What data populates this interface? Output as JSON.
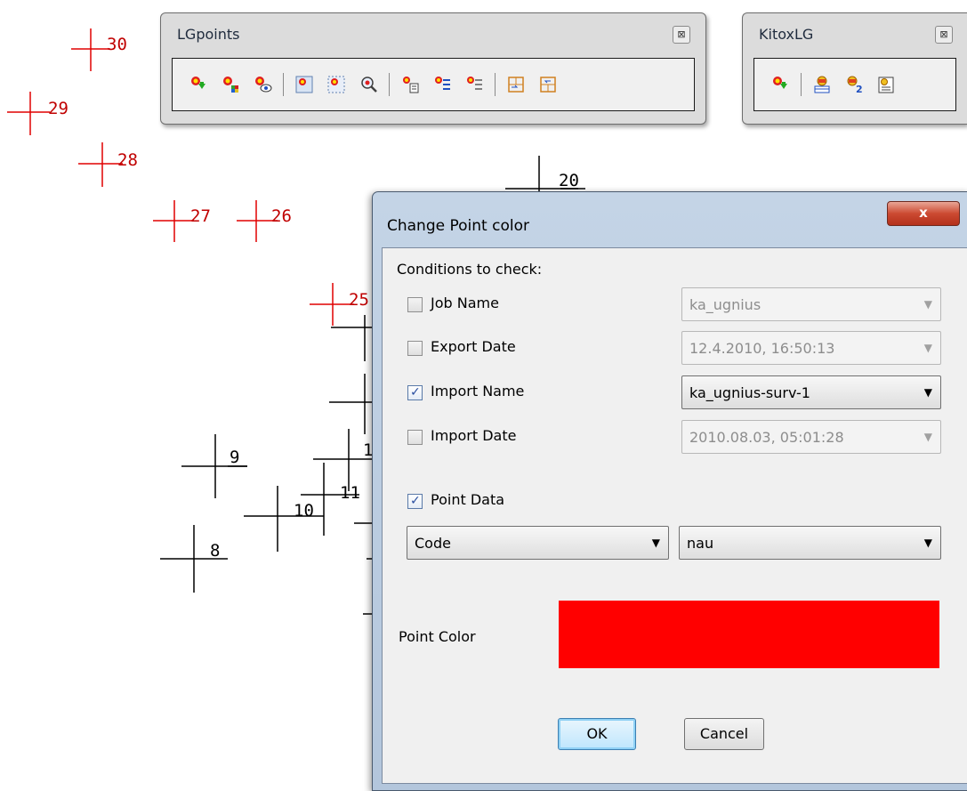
{
  "canvas": {
    "point_labels": [
      "30",
      "29",
      "28",
      "27",
      "26",
      "25",
      "20",
      "9",
      "11",
      "10",
      "8",
      "1"
    ]
  },
  "toolbars": {
    "lgpoints": {
      "title": "LGpoints",
      "close_glyph": "⊠",
      "buttons": [
        "point-download-icon",
        "point-color-icon",
        "point-view-icon",
        "point-select-icon",
        "point-area-select-icon",
        "point-zoom-icon",
        "point-list-icon",
        "point-attributes-icon",
        "point-attributes-alt-icon",
        "export-frame-icon",
        "export-frame-alt-icon"
      ]
    },
    "kitoxlg": {
      "title": "KitoxLG",
      "close_glyph": "⊠",
      "buttons": [
        "kitox-download-icon",
        "kitox-table-icon",
        "kitox-convert-icon",
        "kitox-report-icon"
      ]
    }
  },
  "dialog": {
    "title": "Change Point color",
    "close_label": "x",
    "conditions_label": "Conditions to check:",
    "conditions": [
      {
        "label": "Job Name",
        "checked": false,
        "value": "ka_ugnius"
      },
      {
        "label": "Export Date",
        "checked": false,
        "value": "12.4.2010, 16:50:13"
      },
      {
        "label": "Import Name",
        "checked": true,
        "value": "ka_ugnius-surv-1"
      },
      {
        "label": "Import Date",
        "checked": false,
        "value": "2010.08.03, 05:01:28"
      }
    ],
    "point_data": {
      "label": "Point Data",
      "checked": true,
      "field": "Code",
      "value": "nau"
    },
    "point_color": {
      "label": "Point Color",
      "color": "#ff0000"
    },
    "ok_label": "OK",
    "cancel_label": "Cancel",
    "check_glyph": "✓",
    "arrow_glyph": "▼"
  }
}
